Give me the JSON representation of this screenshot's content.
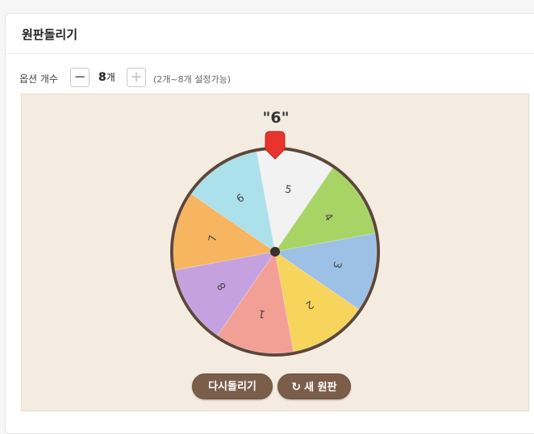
{
  "card": {
    "title": "원판돌리기"
  },
  "options": {
    "label": "옵션 개수",
    "minus_label": "−",
    "plus_label": "+",
    "count": "8",
    "count_unit": "개",
    "hint": "(2개~8개 설정가능)"
  },
  "wheel": {
    "result": "\"6\"",
    "pointer_color": "#e8352c",
    "rim_color": "#5b4638",
    "segments": [
      {
        "label": "1",
        "color": "#f2a096"
      },
      {
        "label": "2",
        "color": "#f7d45c"
      },
      {
        "label": "3",
        "color": "#9dc0e6"
      },
      {
        "label": "4",
        "color": "#a8d466"
      },
      {
        "label": "5",
        "color": "#f2f2f2"
      },
      {
        "label": "6",
        "color": "#ace0ea"
      },
      {
        "label": "7",
        "color": "#f7b55f"
      },
      {
        "label": "8",
        "color": "#c6a1e0"
      }
    ]
  },
  "actions": {
    "spin_label": "다시돌리기",
    "new_label": "새 원판",
    "new_icon": "refresh-icon"
  }
}
